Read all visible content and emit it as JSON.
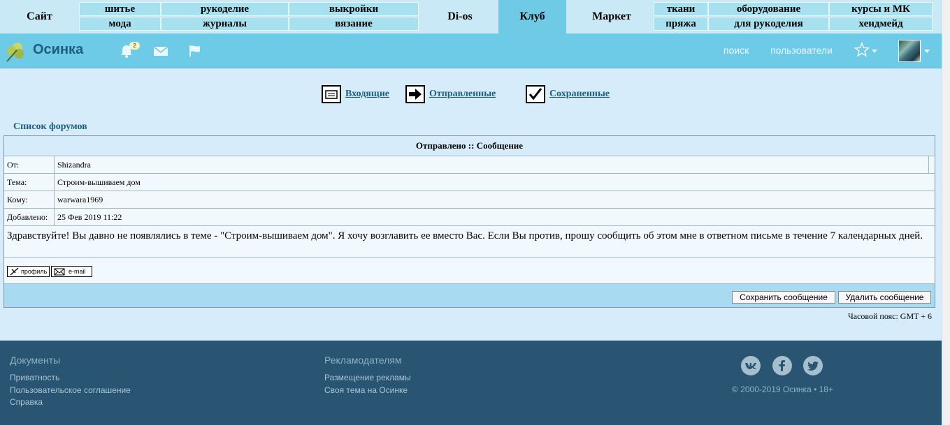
{
  "topnav": {
    "site": "Сайт",
    "cells_left": [
      [
        "шитье",
        "рукоделие",
        "выкройки"
      ],
      [
        "мода",
        "журналы",
        "вязание"
      ]
    ],
    "dios": "Di-os",
    "club": "Клуб",
    "market": "Маркет",
    "cells_right": [
      [
        "ткани",
        "оборудование",
        "курсы и МК"
      ],
      [
        "пряжа",
        "для рукоделия",
        "хендмейд"
      ]
    ]
  },
  "header": {
    "logo": "Осинка",
    "notifications_count": "2",
    "search": "поиск",
    "users": "пользователи"
  },
  "mailbox": {
    "inbox": "Входящие",
    "sent": "Отправленные",
    "saved": "Сохраненные"
  },
  "forum_list": "Список форумов",
  "message": {
    "heading": "Отправлено :: Сообщение",
    "fields": [
      {
        "label": "От:",
        "value": "Shizandra"
      },
      {
        "label": "Тема:",
        "value": "Строим-вышиваем дом"
      },
      {
        "label": "Кому:",
        "value": "warwara1969"
      },
      {
        "label": "Добавлено:",
        "value": "25 Фев 2019 11:22"
      }
    ],
    "body": "Здравствуйте! Вы давно не появлялись в теме - \"Строим-вышиваем дом\". Я хочу возглавить ее вместо Вас. Если Вы против, прошу сообщить об этом мне в ответном письме в течение 7 календарных дней.",
    "profile_btn": "профиль",
    "email_btn": "e-mail",
    "save_btn": "Сохранить сообщение",
    "delete_btn": "Удалить сообщение"
  },
  "timezone": "Часовой пояс: GMT + 6",
  "footer": {
    "docs_title": "Документы",
    "docs": [
      "Приватность",
      "Пользовательское соглашение",
      "Справка"
    ],
    "ads_title": "Рекламодателям",
    "ads": [
      "Размещение рекламы",
      "Своя тема на Осинке"
    ],
    "copyright": "© 2000-2019 Осинка • 18+"
  },
  "colors": {
    "topnav_bg": "#c9e9f6",
    "header_bg": "#6ecbe7",
    "link": "#1b5f7d",
    "footer_bg": "#2a5572"
  }
}
